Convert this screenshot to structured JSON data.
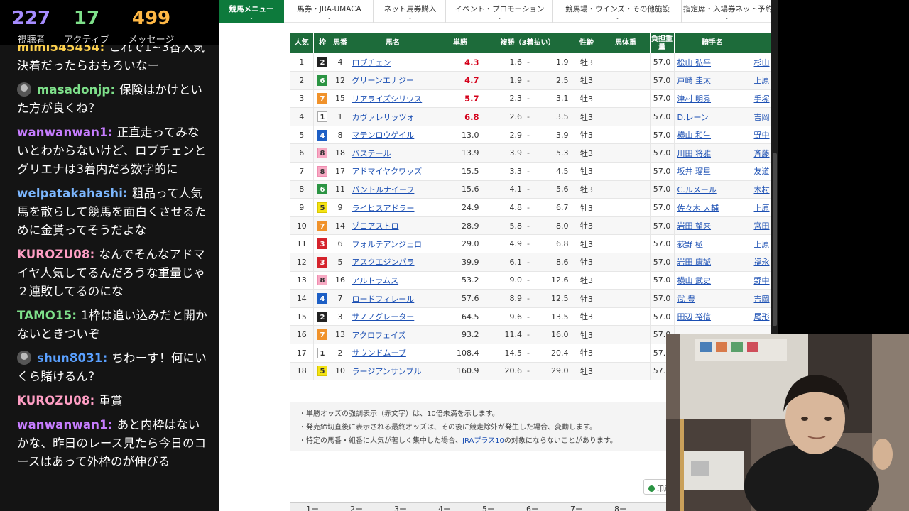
{
  "stats": {
    "viewers": {
      "value": "227",
      "label": "視聴者"
    },
    "active": {
      "value": "17",
      "label": "アクティブ"
    },
    "messages": {
      "value": "499",
      "label": "メッセージ"
    }
  },
  "chat": [
    {
      "user": "mimi545454",
      "user_color": "#ffd24d",
      "text": "これで1~3番人気決着だったらおもろいなー",
      "avatar": false
    },
    {
      "user": "masadonjp",
      "user_color": "#7ee08a",
      "text": "保険はかけといた方が良くね？",
      "avatar": true
    },
    {
      "user": "wanwanwan1",
      "user_color": "#c77dff",
      "text": "正直走ってみないとわからないけど、ロブチェンとグリエナは3着内だろ数字的に",
      "avatar": false
    },
    {
      "user": "welpatakahashi",
      "user_color": "#7cb7ff",
      "text": "粗品って人気馬を散らして競馬を面白くさせるために金貰ってそうだよな",
      "avatar": false
    },
    {
      "user": "KUROZU08",
      "user_color": "#ff9ec4",
      "text": "なんでそんなアドマイヤ人気してるんだろうな重量じゃ２連敗してるのにな",
      "avatar": false
    },
    {
      "user": "TAMO15",
      "user_color": "#7ee08a",
      "text": "1枠は追い込みだと開かないときついぞ",
      "avatar": false
    },
    {
      "user": "shun8031",
      "user_color": "#5aa0ff",
      "text": "ちわーす！何にいくら賭けるん？",
      "avatar": true
    },
    {
      "user": "KUROZU08",
      "user_color": "#ff9ec4",
      "text": "重賞",
      "avatar": false
    },
    {
      "user": "wanwanwan1",
      "user_color": "#c77dff",
      "text": "あと内枠はないかな、昨日のレース見たら今日のコースはあって外枠のが伸びる",
      "avatar": false
    }
  ],
  "nav": [
    {
      "label": "競馬メニュー",
      "active": true
    },
    {
      "label": "馬券・JRA-UMACA",
      "active": false
    },
    {
      "label": "ネット馬券購入",
      "active": false
    },
    {
      "label": "イベント・プロモーション",
      "active": false
    },
    {
      "label": "競馬場・ウインズ・その他施設",
      "active": false
    },
    {
      "label": "指定席・入場券ネット予約",
      "active": false
    }
  ],
  "table": {
    "headers": [
      "人気",
      "枠",
      "馬番",
      "馬名",
      "単勝",
      "複勝（3着払い）",
      "性齢",
      "馬体重",
      "負担重量",
      "騎手名",
      ""
    ],
    "rows": [
      {
        "rank": "1",
        "waku": "2",
        "num": "4",
        "name": "ロブチェン",
        "win": "4.3",
        "hot": true,
        "pmin": "1.6",
        "pmax": "1.9",
        "sex": "牡3",
        "weight": "",
        "load": "57.0",
        "jockey": "松山 弘平",
        "trainer": "杉山"
      },
      {
        "rank": "2",
        "waku": "6",
        "num": "12",
        "name": "グリーンエナジー",
        "win": "4.7",
        "hot": true,
        "pmin": "1.9",
        "pmax": "2.5",
        "sex": "牡3",
        "weight": "",
        "load": "57.0",
        "jockey": "戸崎 圭太",
        "trainer": "上原"
      },
      {
        "rank": "3",
        "waku": "7",
        "num": "15",
        "name": "リアライズシリウス",
        "win": "5.7",
        "hot": true,
        "pmin": "2.3",
        "pmax": "3.1",
        "sex": "牡3",
        "weight": "",
        "load": "57.0",
        "jockey": "津村 明秀",
        "trainer": "手塚"
      },
      {
        "rank": "4",
        "waku": "1",
        "num": "1",
        "name": "カヴァレリッツォ",
        "win": "6.8",
        "hot": true,
        "pmin": "2.6",
        "pmax": "3.5",
        "sex": "牡3",
        "weight": "",
        "load": "57.0",
        "jockey": "D.レーン",
        "trainer": "吉岡"
      },
      {
        "rank": "5",
        "waku": "4",
        "num": "8",
        "name": "マテンロウゲイル",
        "win": "13.0",
        "hot": false,
        "pmin": "2.9",
        "pmax": "3.9",
        "sex": "牡3",
        "weight": "",
        "load": "57.0",
        "jockey": "横山 和生",
        "trainer": "野中"
      },
      {
        "rank": "6",
        "waku": "8",
        "num": "18",
        "name": "バステール",
        "win": "13.9",
        "hot": false,
        "pmin": "3.9",
        "pmax": "5.3",
        "sex": "牡3",
        "weight": "",
        "load": "57.0",
        "jockey": "川田 将雅",
        "trainer": "斉藤"
      },
      {
        "rank": "7",
        "waku": "8",
        "num": "17",
        "name": "アドマイヤクワッズ",
        "win": "15.5",
        "hot": false,
        "pmin": "3.3",
        "pmax": "4.5",
        "sex": "牡3",
        "weight": "",
        "load": "57.0",
        "jockey": "坂井 瑠星",
        "trainer": "友道"
      },
      {
        "rank": "8",
        "waku": "6",
        "num": "11",
        "name": "パントルナイーフ",
        "win": "15.6",
        "hot": false,
        "pmin": "4.1",
        "pmax": "5.6",
        "sex": "牡3",
        "weight": "",
        "load": "57.0",
        "jockey": "C.ルメール",
        "trainer": "木村"
      },
      {
        "rank": "9",
        "waku": "5",
        "num": "9",
        "name": "ライヒスアドラー",
        "win": "24.9",
        "hot": false,
        "pmin": "4.8",
        "pmax": "6.7",
        "sex": "牡3",
        "weight": "",
        "load": "57.0",
        "jockey": "佐々木 大輔",
        "trainer": "上原"
      },
      {
        "rank": "10",
        "waku": "7",
        "num": "14",
        "name": "ゾロアストロ",
        "win": "28.9",
        "hot": false,
        "pmin": "5.8",
        "pmax": "8.0",
        "sex": "牡3",
        "weight": "",
        "load": "57.0",
        "jockey": "岩田 望来",
        "trainer": "宮田"
      },
      {
        "rank": "11",
        "waku": "3",
        "num": "6",
        "name": "フォルテアンジェロ",
        "win": "29.0",
        "hot": false,
        "pmin": "4.9",
        "pmax": "6.8",
        "sex": "牡3",
        "weight": "",
        "load": "57.0",
        "jockey": "荻野 極",
        "trainer": "上原"
      },
      {
        "rank": "12",
        "waku": "3",
        "num": "5",
        "name": "アスクエジンバラ",
        "win": "39.9",
        "hot": false,
        "pmin": "6.1",
        "pmax": "8.6",
        "sex": "牡3",
        "weight": "",
        "load": "57.0",
        "jockey": "岩田 康誠",
        "trainer": "福永"
      },
      {
        "rank": "13",
        "waku": "8",
        "num": "16",
        "name": "アルトラムス",
        "win": "53.2",
        "hot": false,
        "pmin": "9.0",
        "pmax": "12.6",
        "sex": "牡3",
        "weight": "",
        "load": "57.0",
        "jockey": "横山 武史",
        "trainer": "野中"
      },
      {
        "rank": "14",
        "waku": "4",
        "num": "7",
        "name": "ロードフィレール",
        "win": "57.6",
        "hot": false,
        "pmin": "8.9",
        "pmax": "12.5",
        "sex": "牡3",
        "weight": "",
        "load": "57.0",
        "jockey": "武 豊",
        "trainer": "吉岡"
      },
      {
        "rank": "15",
        "waku": "2",
        "num": "3",
        "name": "サノノグレーター",
        "win": "64.5",
        "hot": false,
        "pmin": "9.6",
        "pmax": "13.5",
        "sex": "牡3",
        "weight": "",
        "load": "57.0",
        "jockey": "田辺 裕信",
        "trainer": "尾形"
      },
      {
        "rank": "16",
        "waku": "7",
        "num": "13",
        "name": "アクロフェイズ",
        "win": "93.2",
        "hot": false,
        "pmin": "11.4",
        "pmax": "16.0",
        "sex": "牡3",
        "weight": "",
        "load": "57.0",
        "jockey": "",
        "trainer": ""
      },
      {
        "rank": "17",
        "waku": "1",
        "num": "2",
        "name": "サウンドムーブ",
        "win": "108.4",
        "hot": false,
        "pmin": "14.5",
        "pmax": "20.4",
        "sex": "牡3",
        "weight": "",
        "load": "57.0",
        "jockey": "",
        "trainer": ""
      },
      {
        "rank": "18",
        "waku": "5",
        "num": "10",
        "name": "ラージアンサンブル",
        "win": "160.9",
        "hot": false,
        "pmin": "20.6",
        "pmax": "29.0",
        "sex": "牡3",
        "weight": "",
        "load": "57.0",
        "jockey": "",
        "trainer": ""
      }
    ]
  },
  "notes": {
    "line1": "単勝オッズの強調表示（赤文字）は、10倍未満を示します。",
    "line2": "発売締切直後に表示される最終オッズは、その後に競走除外が発生した場合、変動します。",
    "line3_pre": "特定の馬番・組番に人気が著しく集中した場合、",
    "line3_link": "JRAプラス10",
    "line3_post": "の対象にならないことがあります。"
  },
  "print_label": "印刷",
  "bottom_tabs": [
    "1ー",
    "2ー",
    "3ー",
    "4ー",
    "5ー",
    "6ー",
    "7ー",
    "8ー"
  ]
}
